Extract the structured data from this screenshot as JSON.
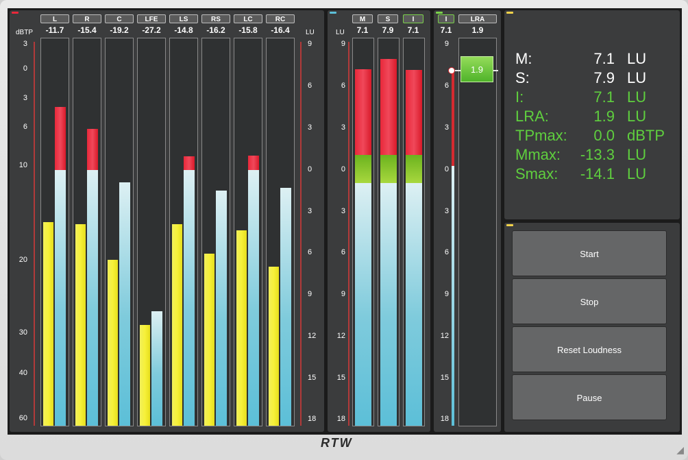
{
  "meters": {
    "unit_left": "dBTP",
    "unit_right": "LU",
    "channels": [
      {
        "label": "L",
        "value": "-11.7"
      },
      {
        "label": "R",
        "value": "-15.4"
      },
      {
        "label": "C",
        "value": "-19.2"
      },
      {
        "label": "LFE",
        "value": "-27.2"
      },
      {
        "label": "LS",
        "value": "-14.8"
      },
      {
        "label": "RS",
        "value": "-16.2"
      },
      {
        "label": "LC",
        "value": "-15.8"
      },
      {
        "label": "RC",
        "value": "-16.4"
      }
    ],
    "dbtp_scale": [
      "3",
      "0",
      "3",
      "6",
      "10",
      "20",
      "30",
      "40",
      "60"
    ],
    "lu_scale": [
      "9",
      "6",
      "3",
      "0",
      "3",
      "6",
      "9",
      "12",
      "15",
      "18"
    ]
  },
  "loudness": {
    "unit": "LU",
    "bars": [
      {
        "label": "M",
        "value": "7.1"
      },
      {
        "label": "S",
        "value": "7.9"
      },
      {
        "label": "I",
        "value": "7.1"
      }
    ],
    "scale": [
      "9",
      "6",
      "3",
      "0",
      "3",
      "6",
      "9",
      "12",
      "15",
      "18"
    ]
  },
  "lra": {
    "i_label": "I",
    "i_value": "7.1",
    "lra_label": "LRA",
    "lra_value": "1.9",
    "marker": "1.9",
    "scale": [
      "9",
      "6",
      "3",
      "0",
      "3",
      "6",
      "9",
      "12",
      "15",
      "18"
    ]
  },
  "summary": [
    {
      "name": "M:",
      "value": "7.1",
      "unit": "LU",
      "color": "white"
    },
    {
      "name": "S:",
      "value": "7.9",
      "unit": "LU",
      "color": "white"
    },
    {
      "name": "I:",
      "value": "7.1",
      "unit": "LU",
      "color": "green"
    },
    {
      "name": "LRA:",
      "value": "1.9",
      "unit": "LU",
      "color": "green"
    },
    {
      "name": "TPmax:",
      "value": "0.0",
      "unit": "dBTP",
      "color": "green"
    },
    {
      "name": "Mmax:",
      "value": "-13.3",
      "unit": "LU",
      "color": "green"
    },
    {
      "name": "Smax:",
      "value": "-14.1",
      "unit": "LU",
      "color": "green"
    }
  ],
  "buttons": {
    "start": "Start",
    "stop": "Stop",
    "reset": "Reset Loudness",
    "pause": "Pause"
  },
  "logo": "RTW",
  "colors": {
    "accent_red": "#e8283a",
    "accent_green": "#5fcf3e",
    "accent_blue": "#5cbfd8",
    "accent_yellow": "#f1ef5a"
  }
}
